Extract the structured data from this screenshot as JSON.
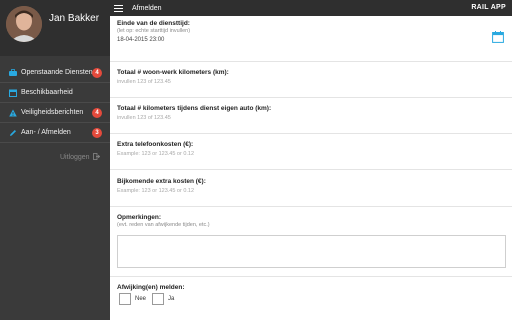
{
  "sidebar": {
    "user_name": "Jan Bakker",
    "items": [
      {
        "label": "Openstaande Diensten",
        "badge": "4",
        "icon": "briefcase-icon"
      },
      {
        "label": "Beschikbaarheid",
        "badge": "",
        "icon": "calendar-icon"
      },
      {
        "label": "Veiligheidsberichten",
        "badge": "4",
        "icon": "warning-icon"
      },
      {
        "label": "Aan- / Afmelden",
        "badge": "3",
        "icon": "pencil-icon"
      }
    ],
    "logout_label": "Uitloggen"
  },
  "topbar": {
    "title": "Afmelden",
    "brand": "RAIL APP"
  },
  "form": {
    "end_time": {
      "label": "Einde van de diensttijd:",
      "hint": "(let op: echte starttijd invullen)",
      "value": "18-04-2015 23:00"
    },
    "commute_km": {
      "label": "Totaal # woon-werk kilometers (km):",
      "placeholder": "invullen 123 of 123.45"
    },
    "own_car_km": {
      "label": "Totaal # kilometers tijdens dienst eigen auto (km):",
      "placeholder": "invullen 123 of 123.45"
    },
    "phone_costs": {
      "label": "Extra telefoonkosten (€):",
      "placeholder": "Example: 123 or 123.45 or 0.12"
    },
    "extra_costs": {
      "label": "Bijkomende extra kosten (€):",
      "placeholder": "Example: 123 or 123.45 or 0.12"
    },
    "remarks": {
      "label": "Opmerkingen:",
      "hint": "(evt. reden van afwijkende tijden, etc.)"
    },
    "deviations": {
      "label": "Afwijking(en) melden:",
      "option_no": "Nee",
      "option_yes": "Ja"
    }
  },
  "colors": {
    "sidebar_bg": "#3a3a3a",
    "topbar_bg": "#2f2f2f",
    "badge": "#e44a3c",
    "accent": "#29a9e0"
  }
}
